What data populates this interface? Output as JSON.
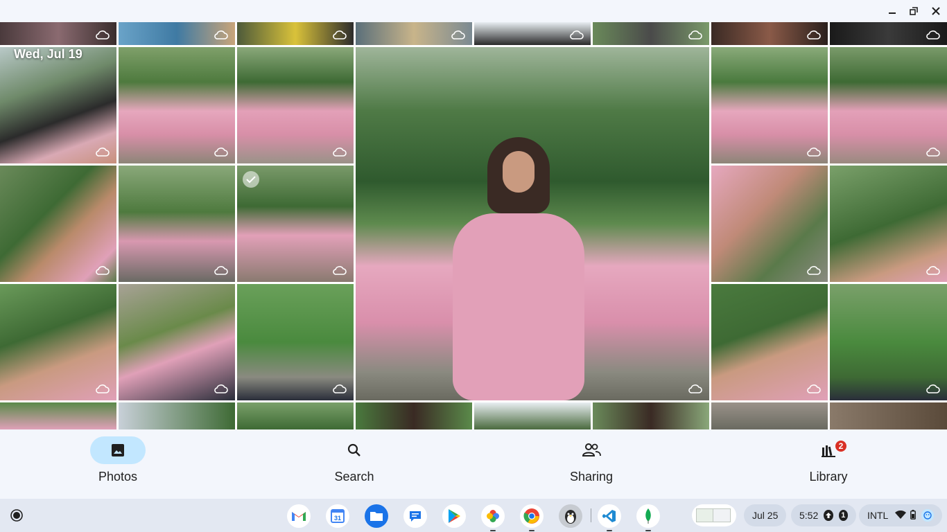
{
  "window": {
    "minimize_icon": "minimize-icon",
    "restore_icon": "restore-icon",
    "close_icon": "close-icon"
  },
  "grid": {
    "date_header": "Wed, Jul 19",
    "cloud_icon": "cloud-icon",
    "selected_icon": "check-circle-icon"
  },
  "bottom_nav": {
    "items": [
      {
        "label": "Photos",
        "icon": "photo-icon",
        "active": true
      },
      {
        "label": "Search",
        "icon": "search-icon",
        "active": false
      },
      {
        "label": "Sharing",
        "icon": "people-icon",
        "active": false
      },
      {
        "label": "Library",
        "icon": "library-icon",
        "active": false,
        "badge": "2"
      }
    ]
  },
  "shelf": {
    "apps": [
      "Gmail",
      "Calendar",
      "Files",
      "Messages",
      "Play Store",
      "Photos",
      "Chrome",
      "Linux Terminal",
      "VS Code",
      "MongoDB Compass"
    ],
    "calendar_day": "31",
    "date": "Jul 25",
    "time": "5:52",
    "notification_count": "1",
    "input_method": "INTL"
  },
  "colors": {
    "accent_pill": "#c2e7ff",
    "badge": "#d93025",
    "shelf_bg": "#e3e8f2"
  }
}
